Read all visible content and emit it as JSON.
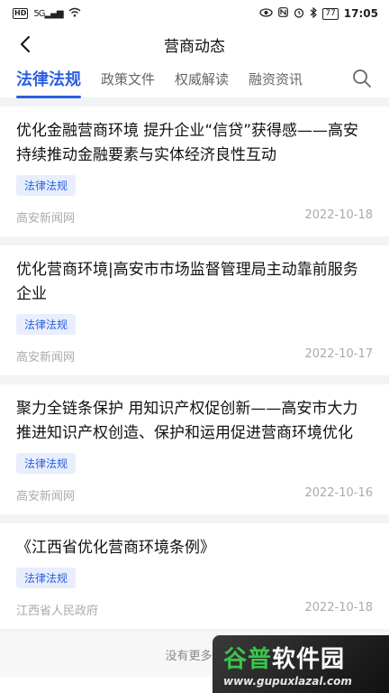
{
  "status_bar": {
    "hd": "HD",
    "signal": "5G",
    "battery": "77",
    "time": "17:05"
  },
  "nav": {
    "title": "营商动态"
  },
  "tabs": [
    {
      "label": "法律法规"
    },
    {
      "label": "政策文件"
    },
    {
      "label": "权威解读"
    },
    {
      "label": "融资资讯"
    }
  ],
  "articles": [
    {
      "title": "优化金融营商环境 提升企业“信贷”获得感——高安持续推动金融要素与实体经济良性互动",
      "tag": "法律法规",
      "source": "高安新闻网",
      "date": "2022-10-18"
    },
    {
      "title": "优化营商环境|高安市市场监督管理局主动靠前服务企业",
      "tag": "法律法规",
      "source": "高安新闻网",
      "date": "2022-10-17"
    },
    {
      "title": "聚力全链条保护 用知识产权促创新——高安市大力推进知识产权创造、保护和运用促进营商环境优化",
      "tag": "法律法规",
      "source": "高安新闻网",
      "date": "2022-10-16"
    },
    {
      "title": "《江西省优化营商环境条例》",
      "tag": "法律法规",
      "source": "江西省人民政府",
      "date": "2022-10-18"
    }
  ],
  "footer": {
    "text": "没有更多数"
  },
  "watermark": {
    "brand_a": "谷普",
    "brand_b": "软件园",
    "url": "www.gupuxlazal.com"
  },
  "colors": {
    "accent": "#2b5fe0",
    "tag_bg": "#e8eefc",
    "band": "#f2f3f5"
  }
}
